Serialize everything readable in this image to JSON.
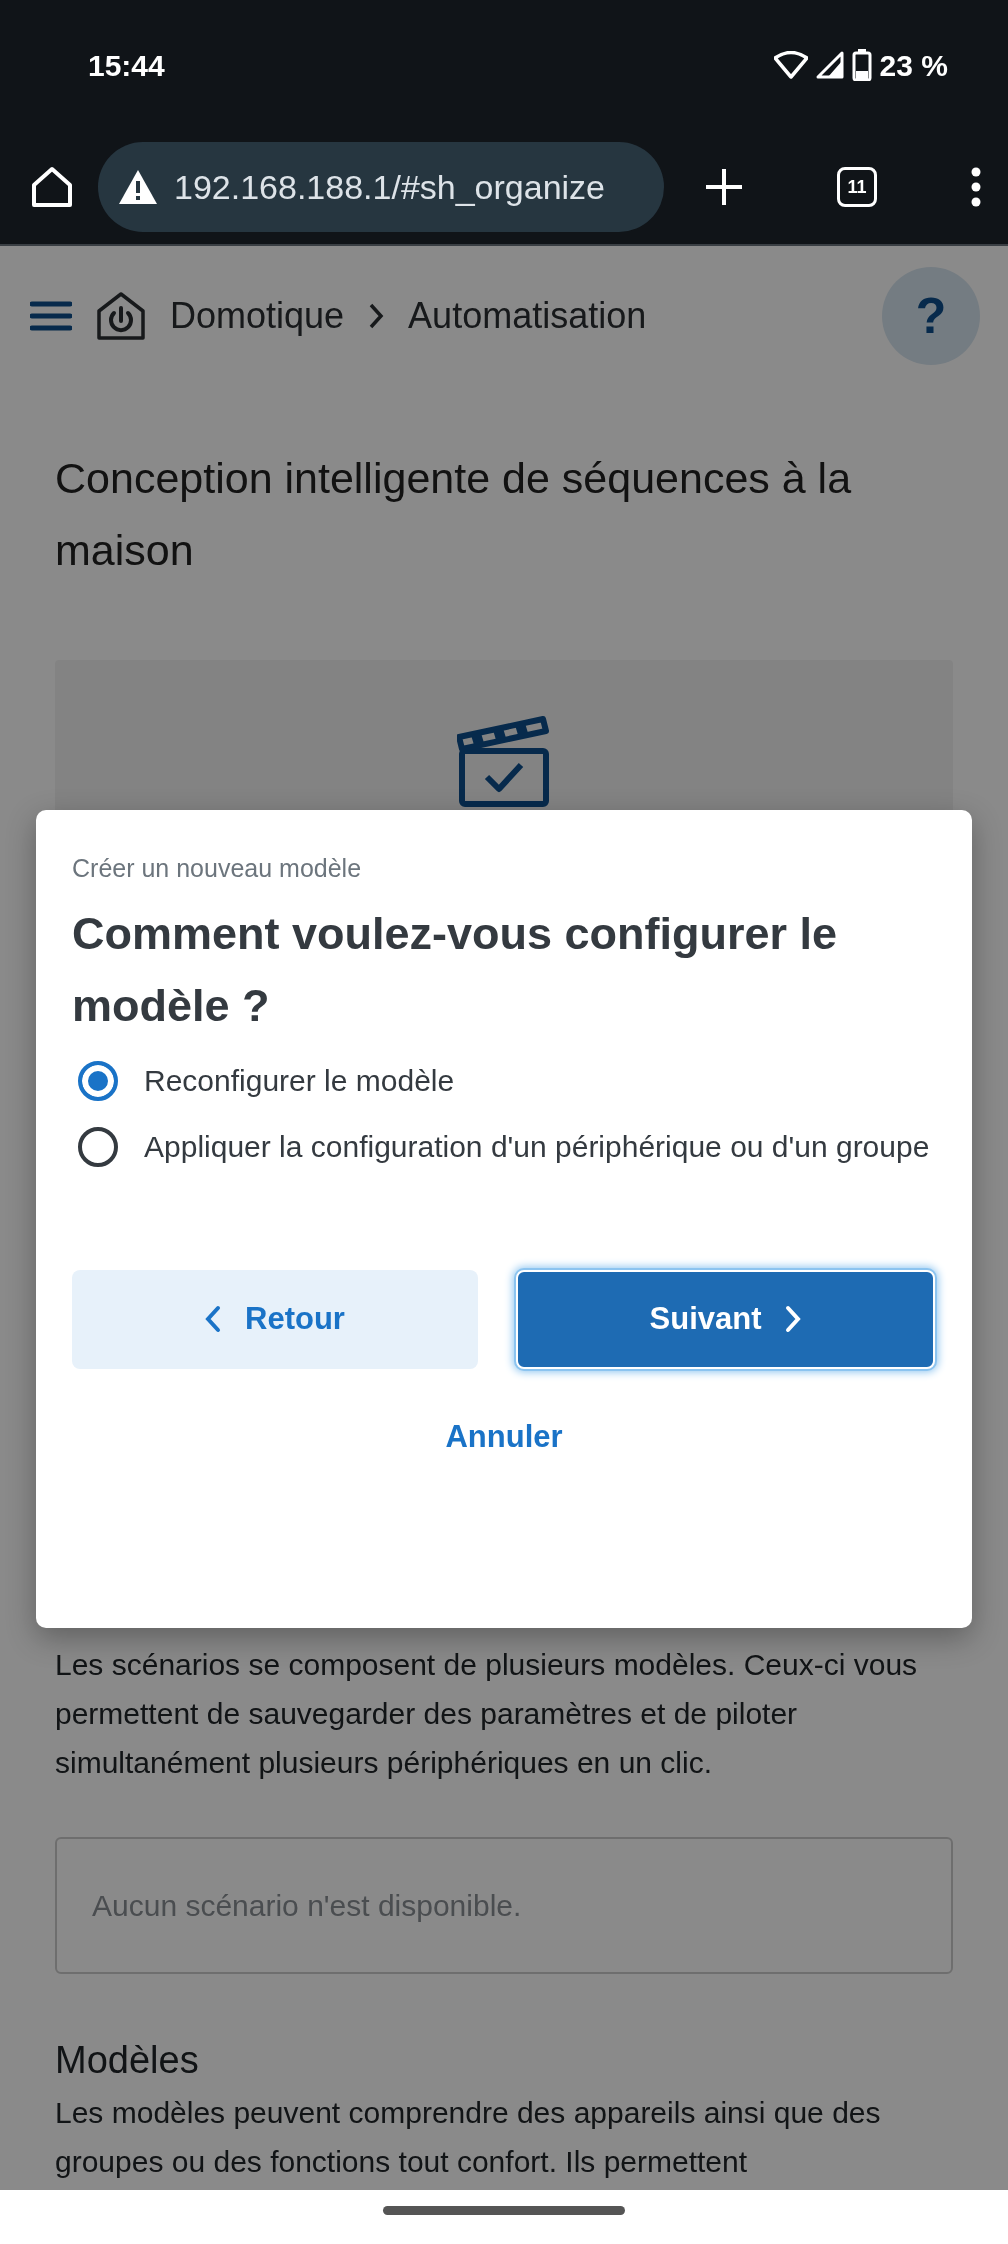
{
  "status_bar": {
    "time": "15:44",
    "battery": "23 %"
  },
  "browser": {
    "url": "192.168.188.1/#sh_organize",
    "tab_count": "11"
  },
  "header": {
    "breadcrumbs": [
      "Domotique",
      "Automatisation"
    ],
    "help": "?"
  },
  "page": {
    "title": "Conception intelligente de séquences à la maison",
    "scenes_text": "Les scénarios se composent de plusieurs modèles. Ceux-ci vous permettent de sauvegarder des paramètres et de piloter simultanément plusieurs périphériques en un clic.",
    "empty_message": "Aucun scénario n'est disponible.",
    "models_heading": "Modèles",
    "models_text": "Les modèles peuvent comprendre des appareils ainsi que des groupes ou des fonctions tout confort. Ils permettent"
  },
  "dialog": {
    "subtitle": "Créer un nouveau modèle",
    "title": "Comment voulez-vous configurer le modèle ?",
    "options": [
      {
        "label": "Reconfigurer le modèle",
        "selected": true
      },
      {
        "label": "Appliquer la configuration d'un périphérique ou d'un groupe",
        "selected": false
      }
    ],
    "buttons": [
      {
        "label": "Retour",
        "kind": "back"
      },
      {
        "label": "Suivant",
        "kind": "next"
      }
    ],
    "cancel": "Annuler"
  }
}
